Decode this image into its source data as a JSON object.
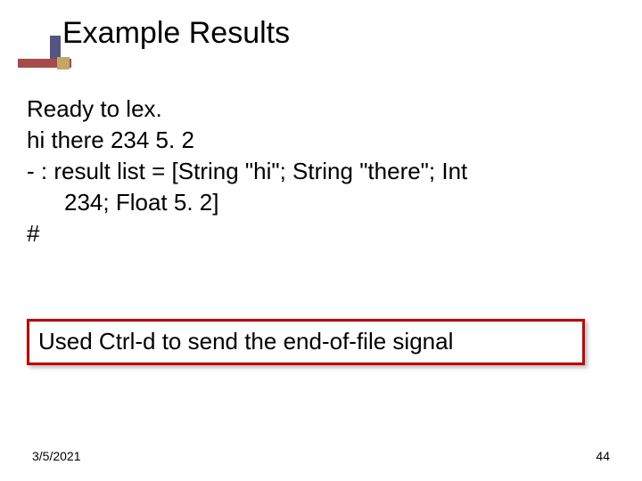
{
  "title": "Example Results",
  "body": {
    "line1": "Ready to lex.",
    "line2": "hi there 234 5. 2",
    "line3a": "- : result list = [String \"hi\"; String \"there\"; Int",
    "line3b": "234; Float 5. 2]",
    "line4": "#"
  },
  "callout": "Used Ctrl-d to send the end-of-file signal",
  "footer": {
    "date": "3/5/2021",
    "page": "44"
  }
}
